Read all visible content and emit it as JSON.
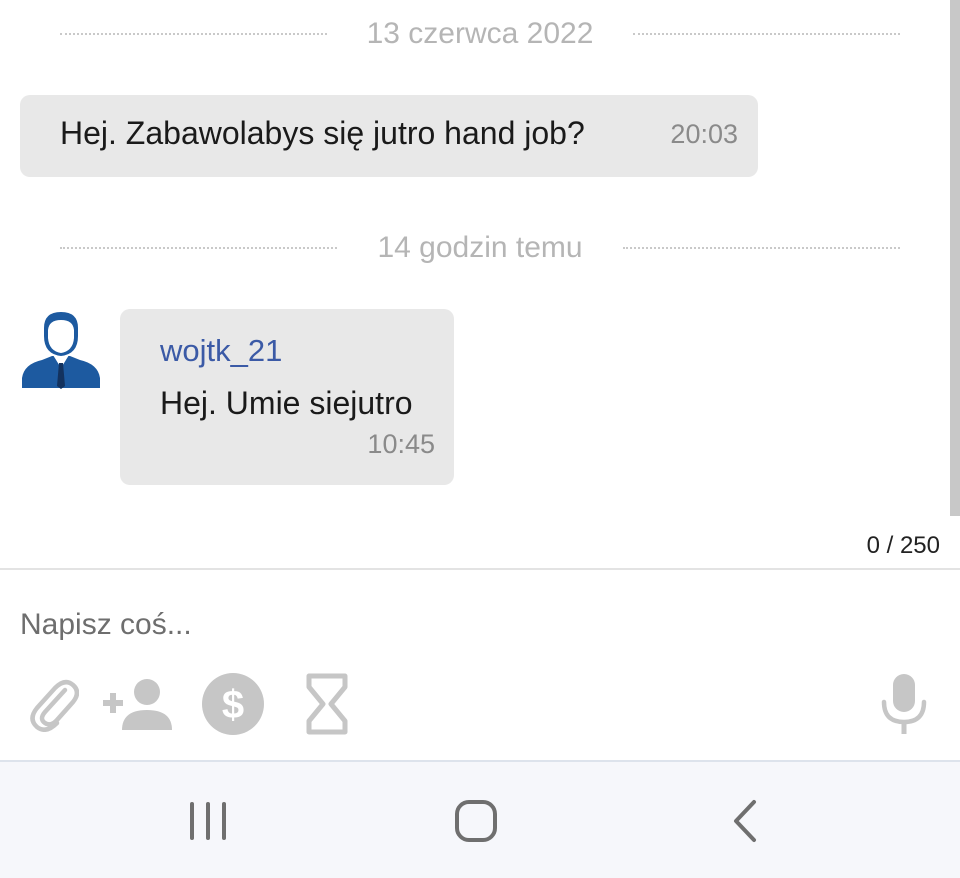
{
  "chat": {
    "date_separators": [
      "13 czerwca 2022",
      "14 godzin temu"
    ],
    "messages": [
      {
        "author": "",
        "text": "Hej. Zabawolabys się jutro hand job?",
        "time": "20:03"
      },
      {
        "author": "wojtk_21",
        "text": "Hej. Umie siejutro",
        "time": "10:45",
        "avatar": "user-silhouette-avatar"
      }
    ]
  },
  "composer": {
    "char_counter": "0 / 250",
    "placeholder": "Napisz coś...",
    "value": "",
    "tools": [
      "paperclip-icon",
      "add-person-icon",
      "dollar-coin-icon",
      "hourglass-icon",
      "microphone-icon"
    ]
  },
  "navbar": {
    "buttons": [
      "recent-apps-icon",
      "home-icon",
      "back-icon"
    ]
  },
  "colors": {
    "bubble": "#e8e8e8",
    "author_name": "#3b5aa6",
    "avatar": "#1d5aa0",
    "icons": "#c6c6c6",
    "navbar_bg": "#f6f7fb"
  }
}
